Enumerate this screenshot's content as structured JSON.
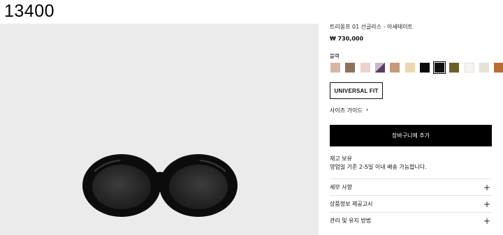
{
  "sku": "13400",
  "product": {
    "title": "트리옹프 01 선글라스 - 아세테이트",
    "price": "₩ 730,000"
  },
  "color_section": {
    "label": "블랙",
    "swatches": [
      {
        "name": "nude-pink",
        "color": "#d7b7a8"
      },
      {
        "name": "brown",
        "color": "#8d7158"
      },
      {
        "name": "light-pink",
        "color": "#ecd2cd"
      },
      {
        "name": "purple-split",
        "color": "#5a3c66"
      },
      {
        "name": "tan",
        "color": "#c59a7a"
      },
      {
        "name": "beige",
        "color": "#ecd7b0"
      },
      {
        "name": "black",
        "color": "#0a0a0a"
      },
      {
        "name": "black-selected",
        "color": "#111111",
        "selected": true
      },
      {
        "name": "olive",
        "color": "#6d5f2c"
      },
      {
        "name": "white",
        "color": "#f7f5f2"
      },
      {
        "name": "ivory",
        "color": "#e7e2d8"
      },
      {
        "name": "caramel",
        "color": "#b86d37"
      }
    ]
  },
  "fit_button": "UNIVERSAL FIT",
  "size_guide": {
    "label": "사이즈 가이드",
    "icon": "chevron-right-icon"
  },
  "cart_button": "장바구니에 추가",
  "stock": {
    "status": "재고 보유",
    "shipping": "영업일 기준 2-5일 이내 배송 가능합니다."
  },
  "accordion": [
    {
      "label": "세부 사항",
      "icon": "plus-icon"
    },
    {
      "label": "상품정보 제공고시",
      "icon": "plus-icon"
    },
    {
      "label": "관리 및 유지 방법",
      "icon": "plus-icon"
    }
  ],
  "colors": {
    "image_bg": "#ebebeb",
    "cart_bg": "#000000"
  }
}
